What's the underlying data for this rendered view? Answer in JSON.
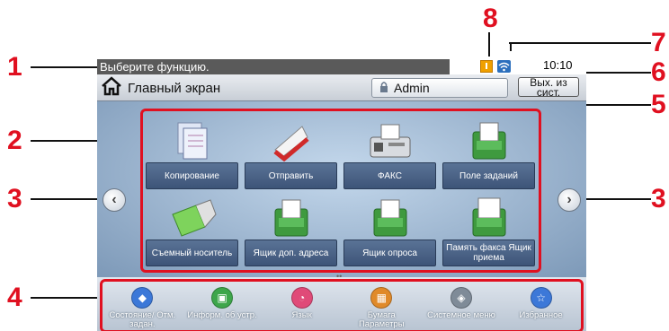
{
  "callouts": {
    "c1": "1",
    "c2": "2",
    "c3_left": "3",
    "c3_right": "3",
    "c4": "4",
    "c5": "5",
    "c6": "6",
    "c7": "7",
    "c8": "8"
  },
  "status_bar": {
    "message": "Выберите функцию.",
    "time": "10:10"
  },
  "topbar": {
    "home_label": "Главный экран",
    "user_label": "Admin",
    "logout_label_line1": "Вых. из",
    "logout_label_line2": "сист."
  },
  "functions": [
    {
      "label": "Копирование",
      "icon": "copy-icon"
    },
    {
      "label": "Отправить",
      "icon": "send-icon"
    },
    {
      "label": "ФАКС",
      "icon": "fax-icon"
    },
    {
      "label": "Поле заданий",
      "icon": "job-box-icon"
    },
    {
      "label": "Съемный носитель",
      "icon": "usb-icon"
    },
    {
      "label": "Ящик доп. адреса",
      "icon": "subaddress-box-icon"
    },
    {
      "label": "Ящик опроса",
      "icon": "polling-box-icon"
    },
    {
      "label": "Память факса Ящик приема",
      "icon": "fax-memory-icon"
    }
  ],
  "quick_items": [
    {
      "label": "Состояние/ Отм. задан.",
      "icon": "status-icon",
      "color": "#3c78d8"
    },
    {
      "label": "Информ. об устр.",
      "icon": "device-info-icon",
      "color": "#3ea64b"
    },
    {
      "label": "Язык",
      "icon": "language-icon",
      "color": "#e04a78"
    },
    {
      "label": "Бумага Параметры",
      "icon": "paper-icon",
      "color": "#e08a2a"
    },
    {
      "label": "Системное меню",
      "icon": "system-menu-icon",
      "color": "#7f8b98"
    },
    {
      "label": "Избранное",
      "icon": "favorites-icon",
      "color": "#3c78d8"
    }
  ],
  "page_indicator": "••"
}
